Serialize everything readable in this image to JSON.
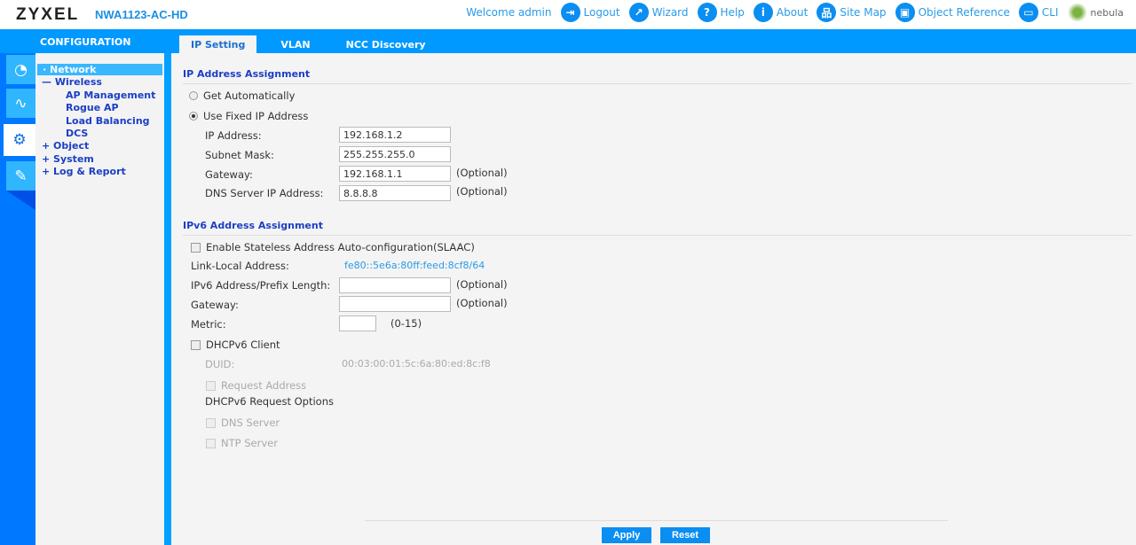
{
  "header": {
    "brand": "ZYXEL",
    "model": "NWA1123-AC-HD",
    "welcome": "Welcome admin",
    "nav": [
      {
        "label": "Logout",
        "icon": "logout-icon"
      },
      {
        "label": "Wizard",
        "icon": "wizard-icon"
      },
      {
        "label": "Help",
        "icon": "help-icon"
      },
      {
        "label": "About",
        "icon": "info-icon"
      },
      {
        "label": "Site Map",
        "icon": "sitemap-icon"
      },
      {
        "label": "Object Reference",
        "icon": "object-reference-icon"
      },
      {
        "label": "CLI",
        "icon": "cli-icon"
      }
    ],
    "nebula": "nebula"
  },
  "sidebar": {
    "title": "CONFIGURATION",
    "tree": {
      "network": "Network",
      "wireless": "Wireless",
      "ap_management": "AP Management",
      "rogue_ap": "Rogue AP",
      "load_balancing": "Load Balancing",
      "dcs": "DCS",
      "object": "Object",
      "system": "System",
      "log_report": "Log & Report"
    }
  },
  "tabs": [
    "IP Setting",
    "VLAN",
    "NCC Discovery"
  ],
  "ipv4": {
    "title": "IP Address Assignment",
    "get_auto": "Get Automatically",
    "use_fixed": "Use Fixed IP Address",
    "ip_label": "IP Address:",
    "ip": "192.168.1.2",
    "mask_label": "Subnet Mask:",
    "mask": "255.255.255.0",
    "gw_label": "Gateway:",
    "gw": "192.168.1.1",
    "dns_label": "DNS Server IP Address:",
    "dns": "8.8.8.8",
    "optional": "(Optional)"
  },
  "ipv6": {
    "title": "IPv6 Address Assignment",
    "slaac": "Enable Stateless Address Auto-configuration(SLAAC)",
    "ll_label": "Link-Local Address:",
    "ll": "fe80::5e6a:80ff:feed:8cf8/64",
    "addr_label": "IPv6 Address/Prefix Length:",
    "addr": "",
    "gw_label": "Gateway:",
    "gw": "",
    "metric_label": "Metric:",
    "metric": "",
    "metric_range": "(0-15)",
    "optional": "(Optional)",
    "dhcp": "DHCPv6 Client",
    "duid_label": "DUID:",
    "duid": "00:03:00:01:5c:6a:80:ed:8c:f8",
    "req_addr": "Request Address",
    "req_opts": "DHCPv6 Request Options",
    "dns_server": "DNS Server",
    "ntp_server": "NTP Server"
  },
  "buttons": {
    "apply": "Apply",
    "reset": "Reset"
  }
}
